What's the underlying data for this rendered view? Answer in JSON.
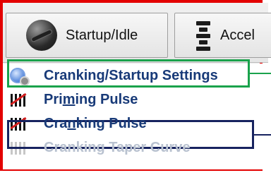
{
  "toolbar": {
    "tabs": [
      {
        "label": "Startup/Idle",
        "icon": "startup-icon"
      },
      {
        "label": "Accel",
        "icon": "accel-icon"
      }
    ]
  },
  "tree": {
    "items": [
      {
        "label": "Cranking/Startup Settings",
        "icon": "settings-icon",
        "state": "enabled"
      },
      {
        "label_parts": [
          "Pri",
          "m",
          "ing Pulse"
        ],
        "icon": "pulse-icon",
        "state": "enabled"
      },
      {
        "label_parts": [
          "Cra",
          "n",
          "king Pulse"
        ],
        "icon": "pulse-icon",
        "state": "enabled"
      },
      {
        "label": "Cranking Taper Curve",
        "icon": "pulse-icon",
        "state": "disabled"
      }
    ]
  },
  "colors": {
    "outer_frame": "#e30000",
    "green_highlight": "#1aa24c",
    "navy_highlight": "#17235f",
    "tree_text": "#183a78"
  }
}
